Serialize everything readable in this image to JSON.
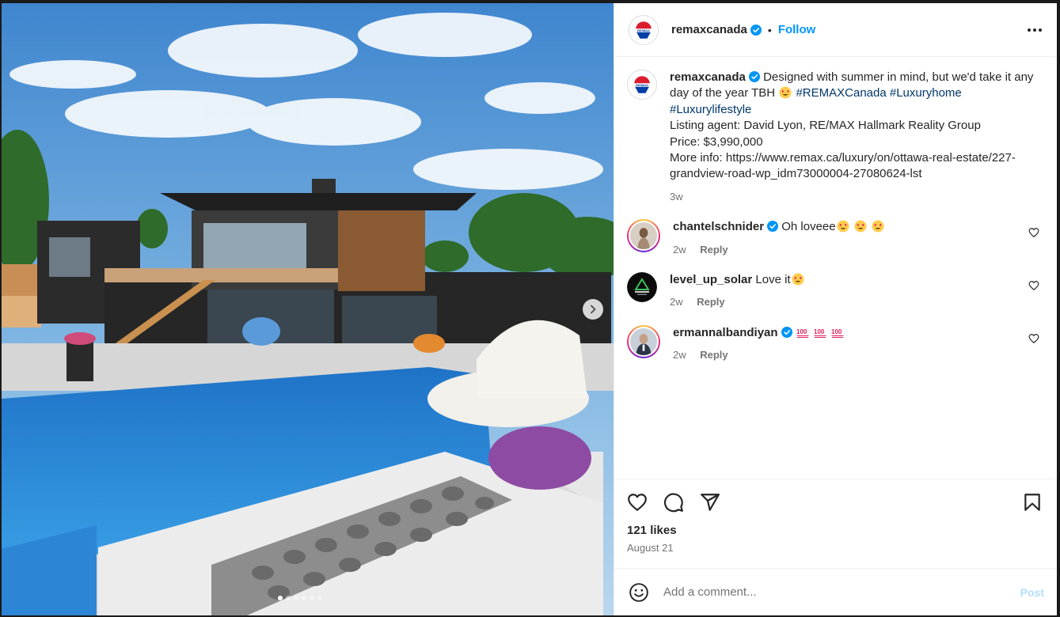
{
  "post": {
    "author": "remaxcanada",
    "separator": "•",
    "follow_label": "Follow",
    "caption": {
      "author": "remaxcanada",
      "text1": "Designed with summer in mind, but we'd take it any day of the year TBH",
      "hashtag1": "#REMAXCanada",
      "hashtag2": "#Luxuryhome",
      "hashtag3": "#Luxurylifestyle",
      "line_agent": "Listing agent: David Lyon, RE/MAX Hallmark Reality Group",
      "line_price": "Price: $3,990,000",
      "line_more": "More info: https://www.remax.ca/luxury/on/ottawa-real-estate/227-grandview-road-wp_idm73000004-27080624-lst",
      "time": "3w"
    },
    "comments": [
      {
        "user": "chantelschnider",
        "text": "Oh loveee",
        "time": "2w",
        "reply": "Reply"
      },
      {
        "user": "level_up_solar",
        "text": "Love it",
        "time": "2w",
        "reply": "Reply"
      },
      {
        "user": "ermannalbandiyan",
        "text": "",
        "time": "2w",
        "reply": "Reply"
      }
    ],
    "likes": "121 likes",
    "date": "August 21",
    "comment_placeholder": "Add a comment...",
    "post_label": "Post",
    "carousel": {
      "slide_count": 6,
      "active_index": 0
    }
  },
  "colors": {
    "link": "#0095f6",
    "hashtag": "#00376b",
    "muted": "#737373",
    "verified": "#0095f6",
    "post_disabled": "#b2dffc"
  }
}
